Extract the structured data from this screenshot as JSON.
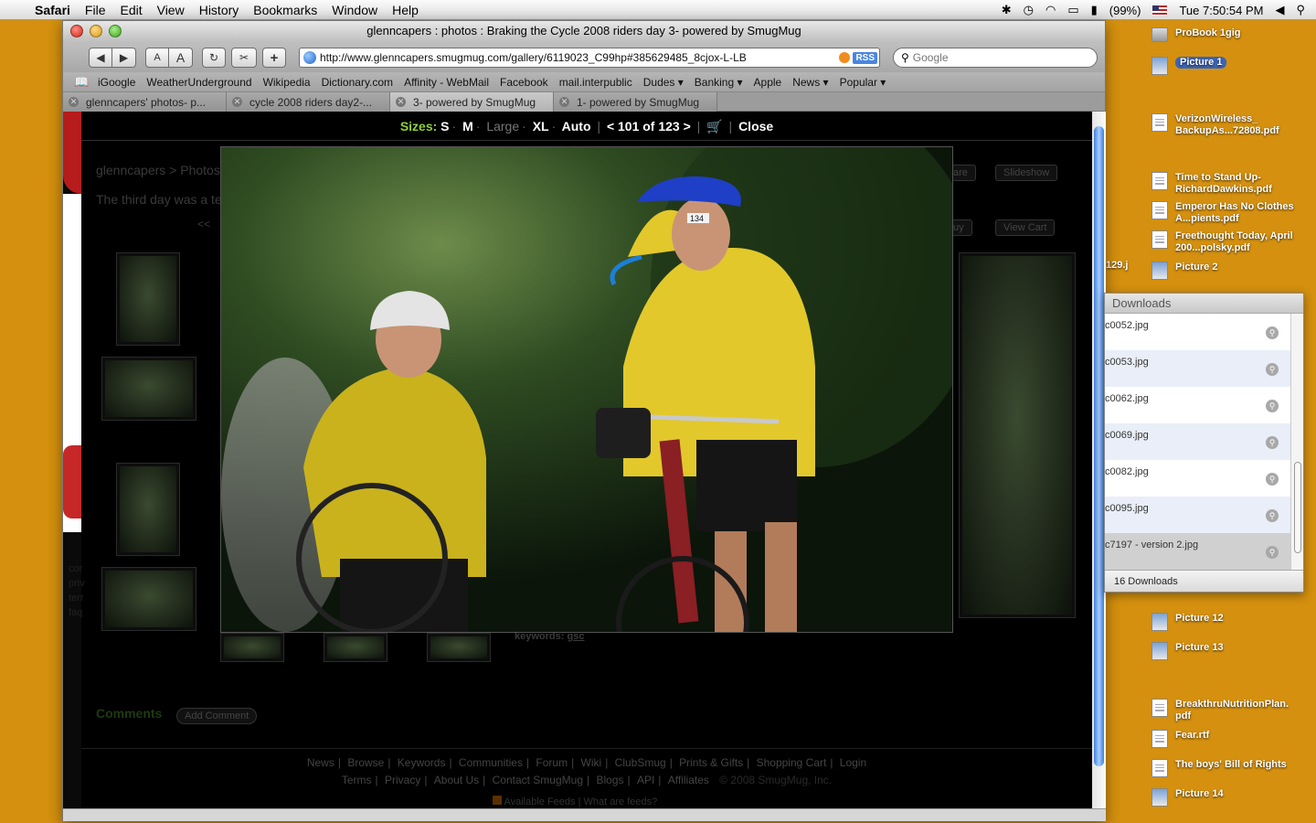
{
  "menubar": {
    "app": "Safari",
    "items": [
      "File",
      "Edit",
      "View",
      "History",
      "Bookmarks",
      "Window",
      "Help"
    ],
    "battery": "(99%)",
    "clock": "Tue 7:50:54 PM"
  },
  "window": {
    "title": "glenncapers : photos : Braking the Cycle 2008 riders day 3- powered by SmugMug",
    "url": "http://www.glenncapers.smugmug.com/gallery/6119023_C99hp#385629485_8cjox-L-LB",
    "rss": "RSS",
    "search_placeholder": "Google",
    "font_small": "A",
    "font_large": "A",
    "add": "+"
  },
  "bookmarks": [
    "iGoogle",
    "WeatherUnderground",
    "Wikipedia",
    "Dictionary.com",
    "Affinity - WebMail",
    "Facebook",
    "mail.interpublic",
    "Dudes ▾",
    "Banking ▾",
    "Apple",
    "News ▾",
    "Popular ▾"
  ],
  "tabs": [
    "glenncapers' photos- p...",
    "cycle 2008 riders day2-...",
    "3- powered by SmugMug",
    "1- powered by SmugMug"
  ],
  "lightbox": {
    "sizes_label": "Sizes:",
    "s": "S",
    "m": "M",
    "large": "Large",
    "xl": "XL",
    "auto": "Auto",
    "counter": "< 101 of 123 >",
    "close": "Close"
  },
  "page": {
    "breadcrumb_user": "glenncapers",
    "breadcrumb_sep": ">",
    "breadcrumb_photos": "Photos",
    "description": "The third day was a te",
    "prev": "<<",
    "share": "are",
    "slideshow": "Slideshow",
    "buy": "uy",
    "view_cart": "View Cart",
    "keywords_label": "keywords:",
    "keywords_value": "gsc",
    "comments": "Comments",
    "add_comment": "Add Comment",
    "footer_row1": [
      "News",
      "Browse",
      "Keywords",
      "Communities",
      "Forum",
      "Wiki",
      "ClubSmug",
      "Prints & Gifts",
      "Shopping Cart",
      "Login"
    ],
    "footer_row2": [
      "Terms",
      "Privacy",
      "About Us",
      "Contact SmugMug",
      "Blogs",
      "API",
      "Affiliates",
      "© 2008 SmugMug, Inc."
    ],
    "footer_row3": [
      "Available Feeds",
      "What are feeds?"
    ],
    "left_links": [
      "cor",
      "priv",
      "terr",
      "faq"
    ]
  },
  "photo": {
    "bib_number": "134"
  },
  "desktop": {
    "icons": [
      {
        "label": "ProBook 1gig",
        "type": "drive"
      },
      {
        "label": "Picture 1",
        "type": "pic",
        "selected": true
      },
      {
        "label": "VerizonWireless_ BackupAs...72808.pdf",
        "type": "doc"
      },
      {
        "label": "Time to Stand Up- RichardDawkins.pdf",
        "type": "doc"
      },
      {
        "label": "Emperor Has No Clothes A...pients.pdf",
        "type": "doc"
      },
      {
        "label": "Freethought Today, April 200...polsky.pdf",
        "type": "doc"
      },
      {
        "label": "Picture 2",
        "type": "pic"
      },
      {
        "label": "Picture 12",
        "type": "pic"
      },
      {
        "label": "Picture 13",
        "type": "pic"
      },
      {
        "label": "BreakthruNutritionPlan. pdf",
        "type": "doc"
      },
      {
        "label": "Fear.rtf",
        "type": "doc"
      },
      {
        "label": "The boys' Bill of Rights",
        "type": "doc"
      },
      {
        "label": "Picture 14",
        "type": "pic"
      }
    ],
    "partial_file": "129.j"
  },
  "downloads": {
    "title": "Downloads",
    "files": [
      "c0052.jpg",
      "c0053.jpg",
      "c0062.jpg",
      "c0069.jpg",
      "c0082.jpg",
      "c0095.jpg",
      "c7197 - version 2.jpg"
    ],
    "count": "16 Downloads"
  }
}
